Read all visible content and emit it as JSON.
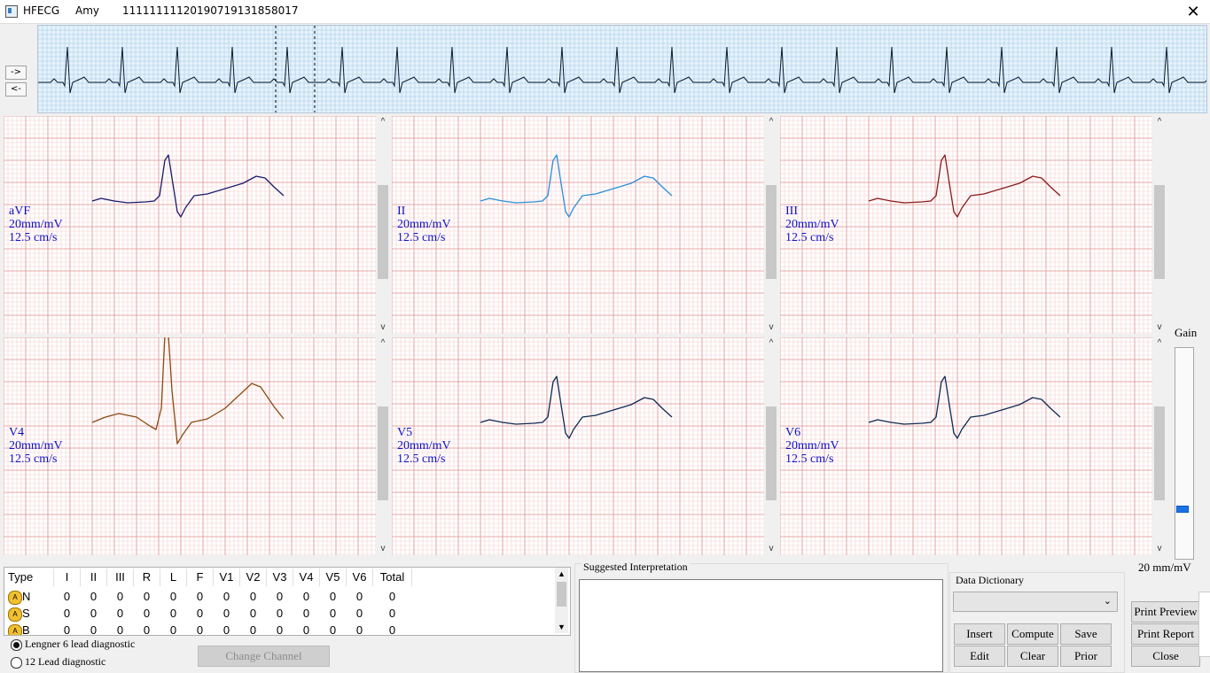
{
  "titlebar": {
    "app": "HFECG",
    "patient": "Amy",
    "record_id": "11111111120190719131858017",
    "close": "✕"
  },
  "rhythm": {
    "forward_label": "->",
    "back_label": "<-"
  },
  "leads": [
    {
      "name": "aVF",
      "gain": "20mm/mV",
      "speed": "12.5 cm/s",
      "color": "#1a1a6e"
    },
    {
      "name": "II",
      "gain": "20mm/mV",
      "speed": "12.5 cm/s",
      "color": "#2a8fd8"
    },
    {
      "name": "III",
      "gain": "20mm/mV",
      "speed": "12.5 cm/s",
      "color": "#8b1a1a"
    },
    {
      "name": "V4",
      "gain": "20mm/mV",
      "speed": "12.5 cm/s",
      "color": "#8b4a12"
    },
    {
      "name": "V5",
      "gain": "20mm/mV",
      "speed": "12.5 cm/s",
      "color": "#102a55"
    },
    {
      "name": "V6",
      "gain": "20mm/mV",
      "speed": "12.5 cm/s",
      "color": "#102a55"
    }
  ],
  "gain": {
    "label": "Gain",
    "value": "20 mm/mV",
    "level_fraction": 0.22
  },
  "beat_table": {
    "headers": [
      "Type",
      "I",
      "II",
      "III",
      "R",
      "L",
      "F",
      "V1",
      "V2",
      "V3",
      "V4",
      "V5",
      "V6",
      "Total"
    ],
    "rows": [
      {
        "type": "N",
        "values": [
          "0",
          "0",
          "0",
          "0",
          "0",
          "0",
          "0",
          "0",
          "0",
          "0",
          "0",
          "0",
          "0"
        ]
      },
      {
        "type": "S",
        "values": [
          "0",
          "0",
          "0",
          "0",
          "0",
          "0",
          "0",
          "0",
          "0",
          "0",
          "0",
          "0",
          "0"
        ]
      },
      {
        "type": "B",
        "values": [
          "0",
          "0",
          "0",
          "0",
          "0",
          "0",
          "0",
          "0",
          "0",
          "0",
          "0",
          "0",
          "0"
        ]
      }
    ]
  },
  "diagnostic_mode": {
    "options": [
      "Lengner 6 lead diagnostic",
      "12 Lead diagnostic"
    ],
    "selected": 0
  },
  "buttons": {
    "change_channel": "Change Channel",
    "insert": "Insert",
    "compute": "Compute",
    "save": "Save",
    "edit": "Edit",
    "clear": "Clear",
    "prior": "Prior",
    "print_preview": "Print Preview",
    "print_report": "Print Report",
    "close": "Close"
  },
  "interpretation": {
    "label": "Suggested Interpretation",
    "text": ""
  },
  "dictionary": {
    "label": "Data Dictionary",
    "selected": ""
  },
  "colors": {
    "grid_major": "#e09090",
    "grid_minor": "#f4cfcf",
    "rhythm_grid": "#9cc6e4",
    "rhythm_bg": "#e6f2fb",
    "label_blue": "#1010c8"
  }
}
